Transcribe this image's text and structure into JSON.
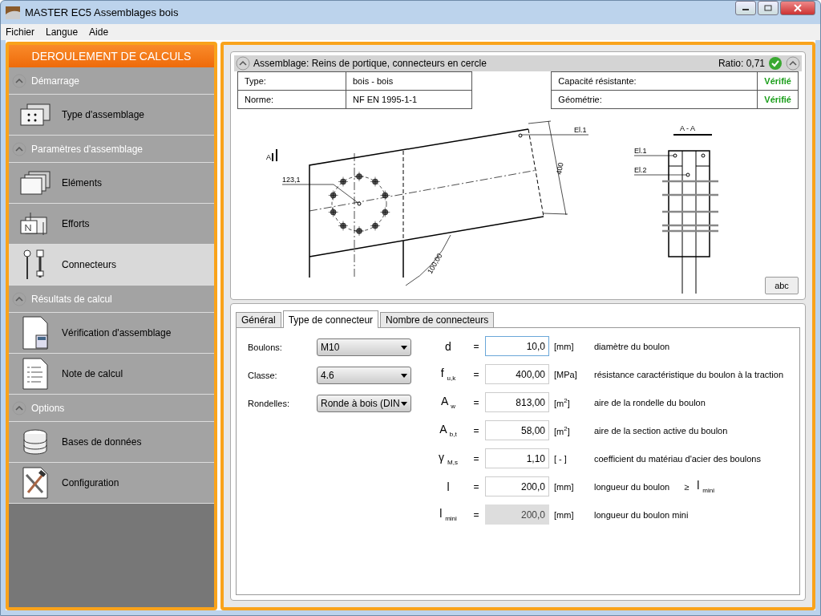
{
  "window": {
    "title": "MASTER EC5 Assemblages bois"
  },
  "menu": [
    "Fichier",
    "Langue",
    "Aide"
  ],
  "sidebar": {
    "title": "DEROULEMENT DE CALCULS",
    "sections": [
      {
        "title": "Démarrage",
        "expanded": true,
        "items": [
          {
            "label": "Type d'assemblage",
            "selected": false
          }
        ]
      },
      {
        "title": "Paramètres d'assemblage",
        "expanded": true,
        "items": [
          {
            "label": "Eléments",
            "selected": false
          },
          {
            "label": "Efforts",
            "selected": false
          },
          {
            "label": "Connecteurs",
            "selected": true
          }
        ]
      },
      {
        "title": "Résultats de calcul",
        "expanded": true,
        "items": [
          {
            "label": "Vérification d'assemblage",
            "selected": false
          },
          {
            "label": "Note de calcul",
            "selected": false
          }
        ]
      },
      {
        "title": "Options",
        "expanded": true,
        "items": [
          {
            "label": "Bases de données",
            "selected": false
          },
          {
            "label": "Configuration",
            "selected": false
          }
        ]
      }
    ]
  },
  "summary": {
    "title": "Assemblage: Reins de portique, connecteurs en cercle",
    "ratio": "Ratio: 0,71",
    "ok": true,
    "properties": [
      {
        "label": "Type:",
        "value": "bois - bois"
      },
      {
        "label": "Norme:",
        "value": "NF EN 1995-1-1"
      }
    ],
    "checks": [
      {
        "label": "Capacité résistante:",
        "value": "Vérifié"
      },
      {
        "label": "Géométrie:",
        "value": "Vérifié"
      }
    ]
  },
  "drawing": {
    "section_mark": "A",
    "bolt_circle_label": "123,1",
    "element_label": "El.1",
    "width_dimension": "400",
    "angle_dimension": "100,00",
    "section_title": "A - A",
    "section_labels": [
      "El.1",
      "El.2"
    ],
    "dimension_button": "abc"
  },
  "tabs": [
    {
      "label": "Général",
      "selected": false
    },
    {
      "label": "Type de connecteur",
      "selected": true
    },
    {
      "label": "Nombre de connecteurs",
      "selected": false
    }
  ],
  "selects": [
    {
      "label": "Boulons:",
      "value": "M10"
    },
    {
      "label": "Classe:",
      "value": "4.6"
    },
    {
      "label": "Rondelles:",
      "value": "Ronde à bois (DIN"
    }
  ],
  "parameters": [
    {
      "symbol": "d",
      "relation": "=",
      "value": "10,0",
      "unit": "[mm]",
      "description": "diamètre du boulon",
      "focused": true,
      "readonly": false
    },
    {
      "symbol": "f $_{u,k}$",
      "relation": "=",
      "value": "400,00",
      "unit": "[MPa]",
      "description": "résistance caractéristique du boulon à la traction",
      "focused": false,
      "readonly": false
    },
    {
      "symbol": "A $_{w}$",
      "relation": "=",
      "value": "813,00",
      "unit": "[m$^{2}$]",
      "description": "aire de la rondelle du boulon",
      "focused": false,
      "readonly": false
    },
    {
      "symbol": "A $_{b,t}$",
      "relation": "=",
      "value": "58,00",
      "unit": "[m$^{2}$]",
      "description": "aire de la section active du boulon",
      "focused": false,
      "readonly": false
    },
    {
      "symbol": "γ $_{M,s}$",
      "relation": "=",
      "value": "1,10",
      "unit": "[ - ]",
      "description": "coefficient du matériau d'acier des boulons",
      "focused": false,
      "readonly": false
    },
    {
      "symbol": "l",
      "relation": "=",
      "value": "200,0",
      "unit": "[mm]",
      "description": "longueur du boulon",
      "condition": "≥",
      "limit": "l $_{mini}$",
      "focused": false,
      "readonly": false
    },
    {
      "symbol": "l $_{mini}$",
      "relation": "=",
      "value": "200,0",
      "unit": "[mm]",
      "description": "longueur du boulon mini",
      "focused": false,
      "readonly": true
    }
  ]
}
